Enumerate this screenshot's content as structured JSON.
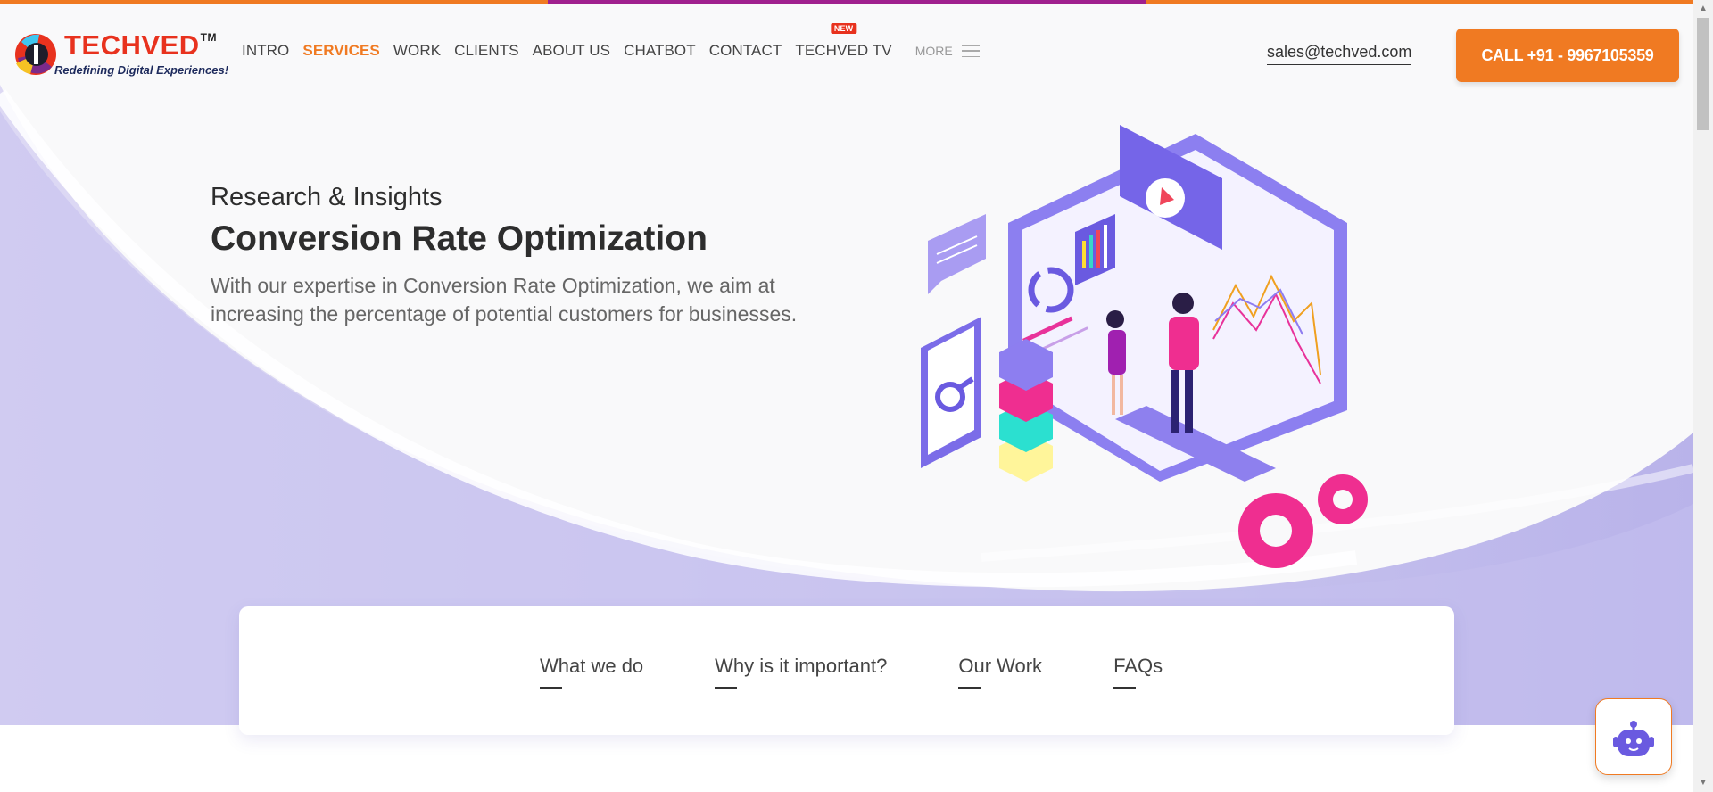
{
  "colors": {
    "accent": "#f07a22",
    "stripe": [
      "#f07a22",
      "#a0208e",
      "#f07a22"
    ],
    "hero_wave": "#c7c3ee",
    "brand_red": "#e8321e",
    "brand_navy": "#1d2a5c"
  },
  "header": {
    "logo": {
      "brand": "TECHVED",
      "trademark": "TM",
      "tagline": "Redefining Digital Experiences!"
    },
    "menu": [
      {
        "label": "INTRO",
        "active": false
      },
      {
        "label": "SERVICES",
        "active": true
      },
      {
        "label": "WORK",
        "active": false
      },
      {
        "label": "CLIENTS",
        "active": false
      },
      {
        "label": "ABOUT US",
        "active": false
      },
      {
        "label": "CHATBOT",
        "active": false
      },
      {
        "label": "CONTACT",
        "active": false
      },
      {
        "label": "TECHVED TV",
        "active": false,
        "badge": "NEW"
      }
    ],
    "more_label": "MORE",
    "more_icon": "hamburger-icon",
    "email": "sales@techved.com",
    "call_label": "CALL +91 - 9967105359"
  },
  "hero": {
    "subtitle": "Research & Insights",
    "title": "Conversion Rate Optimization",
    "description": "With our expertise in Conversion Rate Optimization, we aim at increasing the percentage of potential customers for businesses.",
    "illustration": "cro-isometric-illustration"
  },
  "tabs": [
    "What we do",
    "Why is it important?",
    "Our Work",
    "FAQs"
  ],
  "chatbot": {
    "icon": "chatbot-icon"
  }
}
